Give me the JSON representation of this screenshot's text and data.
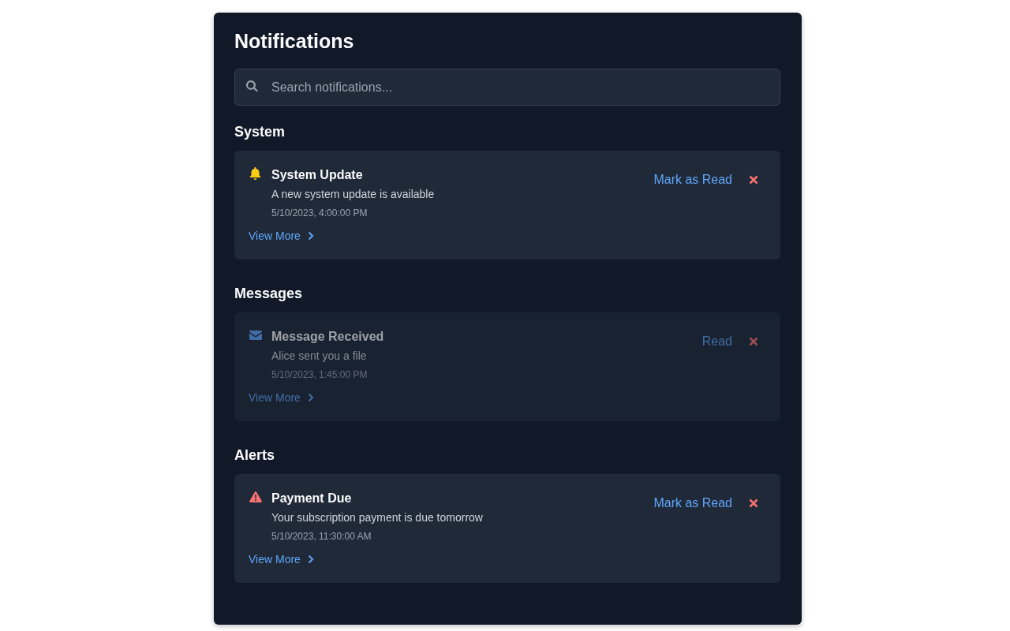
{
  "title": "Notifications",
  "search": {
    "placeholder": "Search notifications..."
  },
  "sections": [
    {
      "heading": "System",
      "notifications": [
        {
          "kind": "bell",
          "title": "System Update",
          "message": "A new system update is available",
          "time": "5/10/2023, 4:00:00 PM",
          "read": false,
          "action": "Mark as Read",
          "link": "View More"
        }
      ]
    },
    {
      "heading": "Messages",
      "notifications": [
        {
          "kind": "envelope",
          "title": "Message Received",
          "message": "Alice sent you a file",
          "time": "5/10/2023, 1:45:00 PM",
          "read": true,
          "action": "Read",
          "link": "View More"
        }
      ]
    },
    {
      "heading": "Alerts",
      "notifications": [
        {
          "kind": "warning",
          "title": "Payment Due",
          "message": "Your subscription payment is due tomorrow",
          "time": "5/10/2023, 11:30:00 AM",
          "read": false,
          "action": "Mark as Read",
          "link": "View More"
        }
      ]
    }
  ]
}
